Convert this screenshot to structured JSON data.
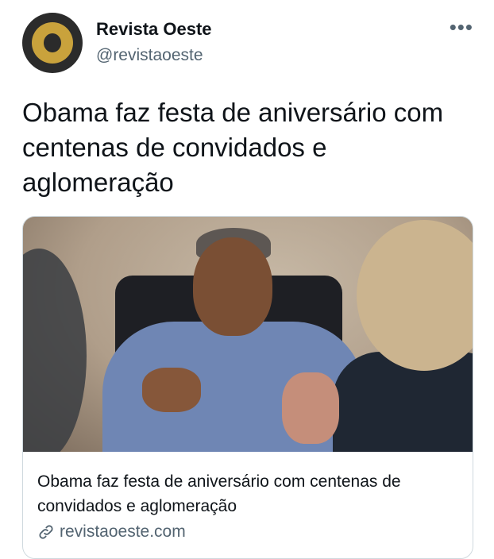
{
  "account": {
    "display_name": "Revista Oeste",
    "handle": "@revistaoeste"
  },
  "tweet": {
    "text": "Obama faz festa de aniversário com centenas de convidados e aglomeração"
  },
  "card": {
    "title": "Obama faz festa de aniversário com centenas de convidados e aglomeração",
    "domain": "revistaoeste.com"
  },
  "icons": {
    "more": "more-icon",
    "link": "link-icon"
  },
  "colors": {
    "avatar_bg": "#2b2b2b",
    "avatar_ring": "#c9a23c",
    "secondary_text": "#536471",
    "primary_text": "#0f1419",
    "border": "#cfd9de"
  }
}
